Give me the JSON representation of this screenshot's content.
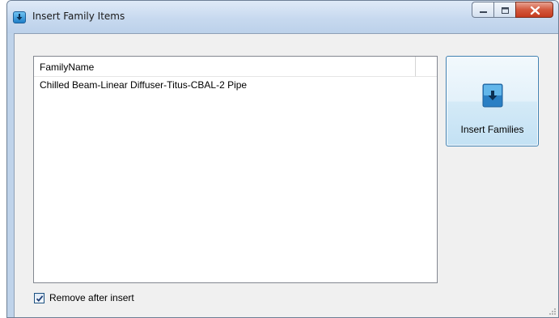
{
  "window": {
    "title": "Insert Family Items",
    "icon": "insert-family-app-icon",
    "caption_buttons": [
      "minimize",
      "maximize",
      "close"
    ]
  },
  "list": {
    "columns": [
      "FamilyName"
    ],
    "rows": [
      "Chilled Beam-Linear Diffuser-Titus-CBAL-2 Pipe"
    ]
  },
  "insert_button": {
    "label": "Insert Families",
    "icon": "insert-families-icon"
  },
  "remove_after_insert": {
    "label": "Remove after insert",
    "checked": true
  },
  "colors": {
    "window_frame": "#bfd3ea",
    "client_bg": "#f0f0f0",
    "close_button": "#c63b1f",
    "accent_button_border": "#3c7fb1"
  }
}
